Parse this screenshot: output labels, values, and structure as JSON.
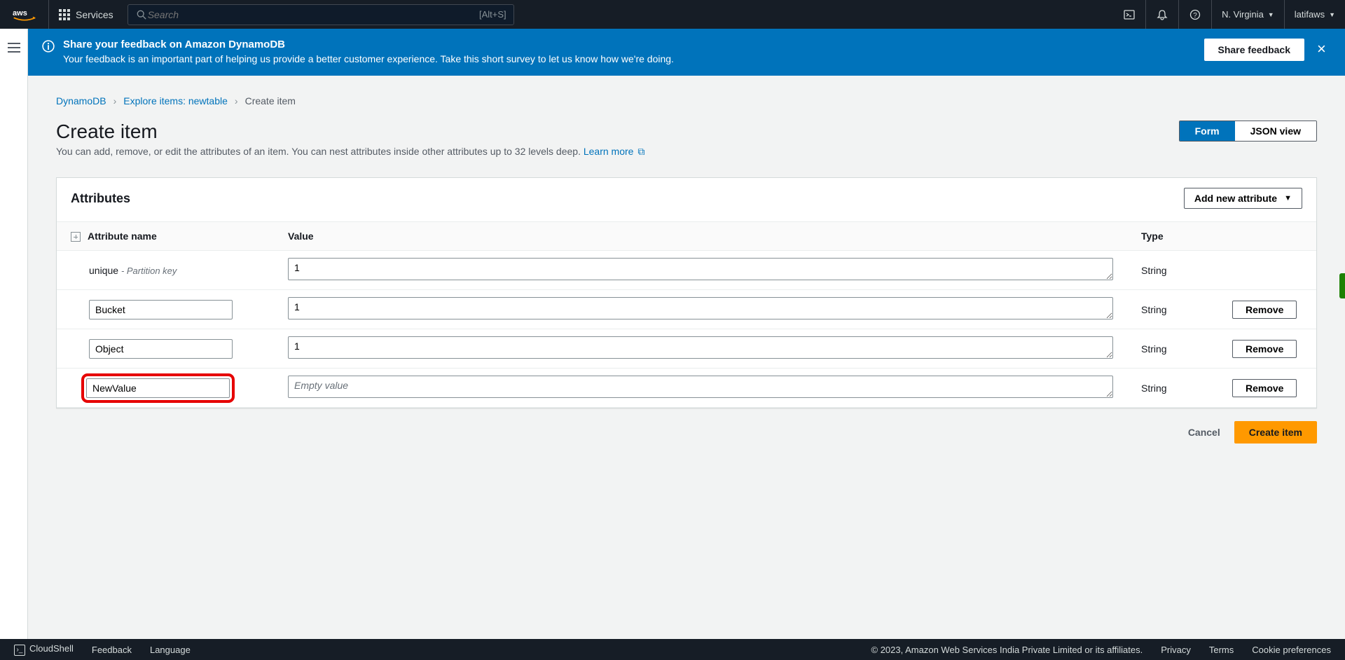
{
  "topnav": {
    "services": "Services",
    "search_placeholder": "Search",
    "search_shortcut": "[Alt+S]",
    "region": "N. Virginia",
    "user": "latifaws"
  },
  "banner": {
    "title": "Share your feedback on Amazon DynamoDB",
    "subtitle": "Your feedback is an important part of helping us provide a better customer experience. Take this short survey to let us know how we're doing.",
    "button": "Share feedback"
  },
  "breadcrumbs": {
    "a": "DynamoDB",
    "b": "Explore items: newtable",
    "c": "Create item"
  },
  "page": {
    "title": "Create item",
    "desc": "You can add, remove, or edit the attributes of an item. You can nest attributes inside other attributes up to 32 levels deep. ",
    "learn_more": "Learn more",
    "view_form": "Form",
    "view_json": "JSON view"
  },
  "panel": {
    "title": "Attributes",
    "add_button": "Add new attribute",
    "col_name": "Attribute name",
    "col_value": "Value",
    "col_type": "Type",
    "remove": "Remove",
    "empty_placeholder": "Empty value"
  },
  "rows": {
    "r0": {
      "name": "unique",
      "sub": "- Partition key",
      "value": "1",
      "type": "String"
    },
    "r1": {
      "name": "Bucket",
      "value": "1",
      "type": "String"
    },
    "r2": {
      "name": "Object",
      "value": "1",
      "type": "String"
    },
    "r3": {
      "name": "NewValue",
      "value": "",
      "type": "String"
    }
  },
  "actions": {
    "cancel": "Cancel",
    "create": "Create item"
  },
  "footer": {
    "cloudshell": "CloudShell",
    "feedback": "Feedback",
    "language": "Language",
    "copyright": "© 2023, Amazon Web Services India Private Limited or its affiliates.",
    "privacy": "Privacy",
    "terms": "Terms",
    "cookies": "Cookie preferences"
  }
}
